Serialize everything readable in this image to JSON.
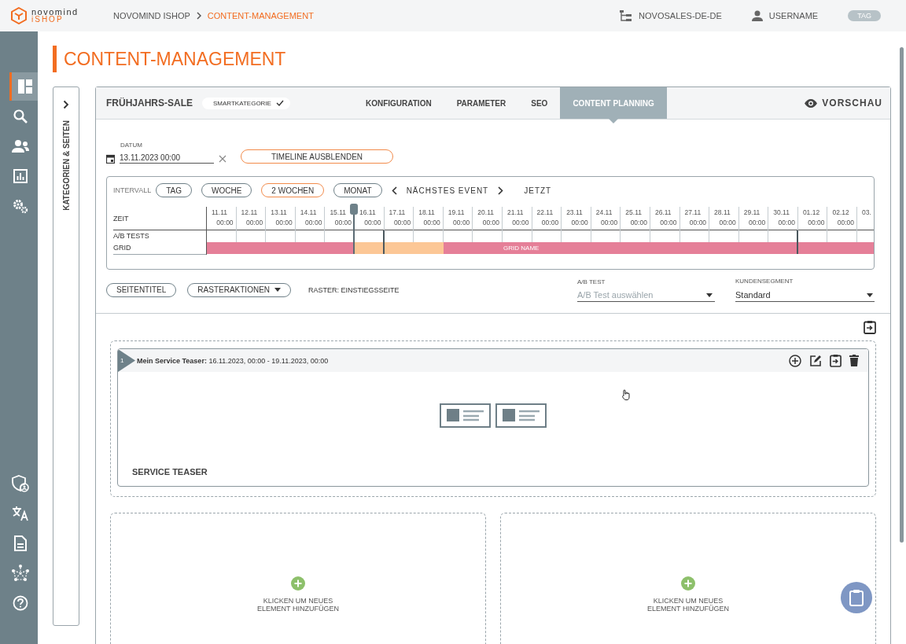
{
  "header": {
    "logo_top": "novomind",
    "logo_bottom": "iSHOP",
    "breadcrumb": [
      {
        "label": "NOVOMIND ISHOP",
        "selected": false
      },
      {
        "label": "CONTENT-MANAGEMENT",
        "selected": true
      }
    ],
    "store": "NOVOSALES-DE-DE",
    "user": "USERNAME",
    "tag": "TAG"
  },
  "sidebar": {
    "top": [
      {
        "kind": "dashboard",
        "selected": true
      },
      {
        "kind": "search",
        "selected": false
      },
      {
        "kind": "users",
        "selected": false
      },
      {
        "kind": "chart",
        "selected": false
      },
      {
        "kind": "settings",
        "selected": false
      }
    ],
    "bottom": [
      {
        "kind": "shield",
        "selected": false
      },
      {
        "kind": "translate",
        "selected": false
      },
      {
        "kind": "document",
        "selected": false
      },
      {
        "kind": "network",
        "selected": false
      },
      {
        "kind": "help",
        "selected": false
      }
    ]
  },
  "page_title": "CONTENT-MANAGEMENT",
  "side_panel": {
    "label": "KATEGORIEN & SEITEN"
  },
  "card": {
    "title": "FRÜHJAHRS-SALE",
    "badge": "SMARTKATEGORIE",
    "badge_checked": true,
    "tabs": [
      {
        "label": "KONFIGURATION",
        "selected": false
      },
      {
        "label": "PARAMETER",
        "selected": false
      },
      {
        "label": "SEO",
        "selected": false
      },
      {
        "label": "CONTENT PLANNING",
        "selected": true
      }
    ],
    "preview": "VORSCHAU"
  },
  "date": {
    "label": "DATUM",
    "value": "13.11.2023 00:00"
  },
  "timeline_toggle": "TIMELINE AUSBLENDEN",
  "timeline": {
    "interval_label": "INTERVALL",
    "intervals": [
      {
        "label": "TAG",
        "selected": false
      },
      {
        "label": "WOCHE",
        "selected": false
      },
      {
        "label": "2 WOCHEN",
        "selected": true
      },
      {
        "label": "MONAT",
        "selected": false
      }
    ],
    "next_event": "NÄCHSTES EVENT",
    "now": "JETZT",
    "row_labels": [
      "ZEIT",
      "A/B TESTS",
      "GRID"
    ],
    "columns": [
      {
        "date": "11.11",
        "time": "00:00",
        "color": "#e57f98"
      },
      {
        "date": "12.11",
        "time": "00:00",
        "color": "#e57f98"
      },
      {
        "date": "13.11",
        "time": "00:00",
        "color": "#e57f98"
      },
      {
        "date": "14.11",
        "time": "00:00",
        "color": "#e57f98"
      },
      {
        "date": "15.11",
        "time": "00:00",
        "color": "#e57f98"
      },
      {
        "date": "16.11",
        "time": "00:00",
        "color": "#fcc796",
        "now": true
      },
      {
        "date": "17.11",
        "time": "00:00",
        "color": "#fcc796",
        "event": true
      },
      {
        "date": "18.11",
        "time": "00:00",
        "color": "#fcc796"
      },
      {
        "date": "19.11",
        "time": "00:00",
        "color": "#e57f98"
      },
      {
        "date": "20.11",
        "time": "00:00",
        "color": "#e57f98"
      },
      {
        "date": "21.11",
        "time": "00:00",
        "color": "#e57f98",
        "label": "GRID NAME"
      },
      {
        "date": "22.11",
        "time": "00:00",
        "color": "#e57f98"
      },
      {
        "date": "23.11",
        "time": "00:00",
        "color": "#e57f98"
      },
      {
        "date": "24.11",
        "time": "00:00",
        "color": "#e57f98"
      },
      {
        "date": "25.11",
        "time": "00:00",
        "color": "#e57f98"
      },
      {
        "date": "26.11",
        "time": "00:00",
        "color": "#e57f98"
      },
      {
        "date": "27.11",
        "time": "00:00",
        "color": "#e57f98"
      },
      {
        "date": "28.11",
        "time": "00:00",
        "color": "#e57f98"
      },
      {
        "date": "29.11",
        "time": "00:00",
        "color": "#e57f98"
      },
      {
        "date": "30.11",
        "time": "00:00",
        "color": "#e57f98"
      },
      {
        "date": "01.12",
        "time": "00:00",
        "color": "#e57f98",
        "event": true
      },
      {
        "date": "02.12",
        "time": "00:00",
        "color": "#e57f98"
      },
      {
        "date": "03.",
        "color": "#e57f98"
      }
    ]
  },
  "toolbar": {
    "page_title_button": "SEITENTITEL",
    "grid_actions": "RASTERAKTIONEN",
    "grid_info": "RASTER: EINSTIEGSSEITE",
    "ab_test": {
      "label": "A/B TEST",
      "placeholder": "A/B Test auswählen"
    },
    "segment": {
      "label": "KUNDENSEGMENT",
      "value": "Standard"
    }
  },
  "elements": [
    {
      "number": "1",
      "title": "**Mein Service Teaser:** 16.11.2023, 00:00 - 19.11.2023, 00:00",
      "type": "SERVICE TEASER"
    }
  ],
  "add_slots": [
    {
      "text": "KLICKEN UM NEUES ELEMENT HINZUFÜGEN"
    },
    {
      "text": "KLICKEN UM NEUES ELEMENT HINZUFÜGEN"
    }
  ]
}
